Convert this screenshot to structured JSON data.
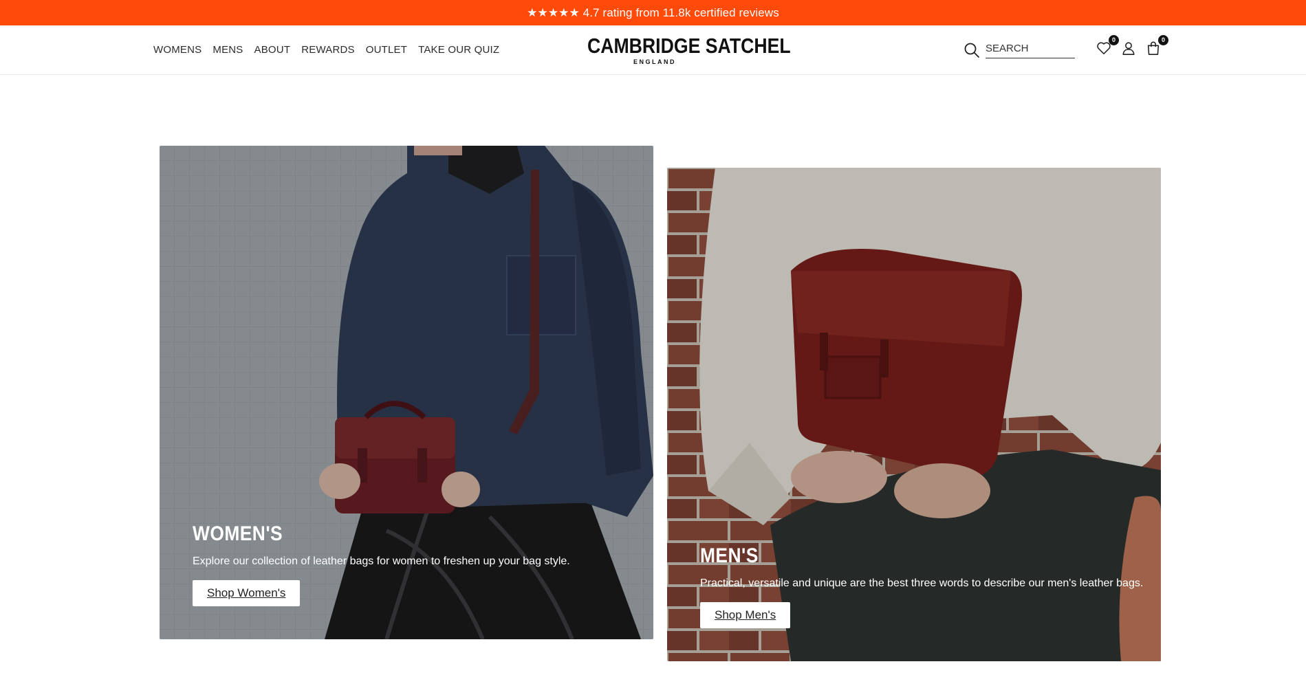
{
  "promo": {
    "text": "★★★★★ 4.7 rating from 11.8k certified reviews"
  },
  "nav": {
    "items": [
      {
        "label": "WOMENS"
      },
      {
        "label": "MENS"
      },
      {
        "label": "ABOUT"
      },
      {
        "label": "REWARDS"
      },
      {
        "label": "OUTLET"
      },
      {
        "label": "TAKE OUR QUIZ"
      }
    ]
  },
  "logo": {
    "main": "CAMBRIDGE SATCHEL",
    "sub": "ENGLAND"
  },
  "search": {
    "placeholder": "SEARCH"
  },
  "wishlist": {
    "count": "0"
  },
  "cart": {
    "count": "0"
  },
  "cards": [
    {
      "title": "WOMEN'S",
      "description": "Explore our collection of leather bags for women to freshen up your bag style.",
      "button": "Shop Women's"
    },
    {
      "title": "MEN'S",
      "description": "Practical, versatile and unique are the best three words to describe our men's leather bags.",
      "button": "Shop Men's"
    }
  ],
  "colors": {
    "promo_bg": "#ff4a0a",
    "bag_oxblood": "#7a2a2a"
  },
  "icons": [
    "search-icon",
    "heart-icon",
    "user-icon",
    "bag-icon"
  ]
}
